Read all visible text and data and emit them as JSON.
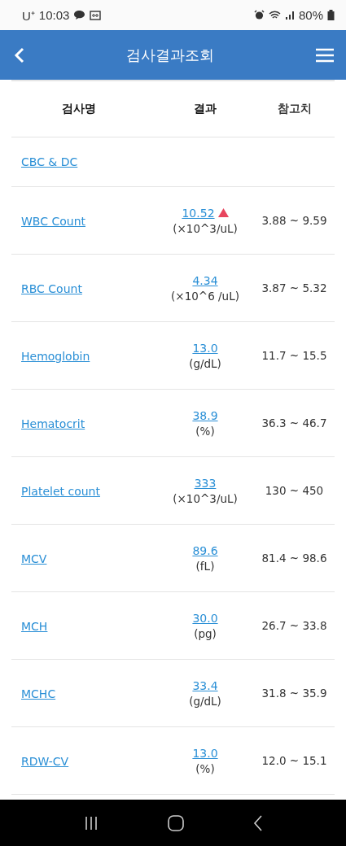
{
  "status_bar": {
    "carrier": "U⁺",
    "time": "10:03",
    "battery": "80%"
  },
  "header": {
    "title": "검사결과조회"
  },
  "table": {
    "columns": [
      "검사명",
      "결과",
      "참고치"
    ],
    "group": "CBC & DC",
    "rows": [
      {
        "name": "WBC Count",
        "value": "10.52",
        "unit": "(×10^3/uL)",
        "reference": "3.88 ~ 9.59",
        "high": true
      },
      {
        "name": "RBC Count",
        "value": "4.34",
        "unit": "(×10^6 /uL)",
        "reference": "3.87 ~ 5.32",
        "high": false
      },
      {
        "name": "Hemoglobin",
        "value": "13.0",
        "unit": "(g/dL)",
        "reference": "11.7 ~ 15.5",
        "high": false
      },
      {
        "name": "Hematocrit",
        "value": "38.9",
        "unit": "(%)",
        "reference": "36.3 ~ 46.7",
        "high": false
      },
      {
        "name": "Platelet count",
        "value": "333",
        "unit": "(×10^3/uL)",
        "reference": "130 ~ 450",
        "high": false
      },
      {
        "name": "MCV",
        "value": "89.6",
        "unit": "(fL)",
        "reference": "81.4 ~ 98.6",
        "high": false
      },
      {
        "name": "MCH",
        "value": "30.0",
        "unit": "(pg)",
        "reference": "26.7 ~ 33.8",
        "high": false
      },
      {
        "name": "MCHC",
        "value": "33.4",
        "unit": "(g/dL)",
        "reference": "31.8 ~ 35.9",
        "high": false
      },
      {
        "name": "RDW-CV",
        "value": "13.0",
        "unit": "(%)",
        "reference": "12.0 ~ 15.1",
        "high": false
      }
    ]
  }
}
